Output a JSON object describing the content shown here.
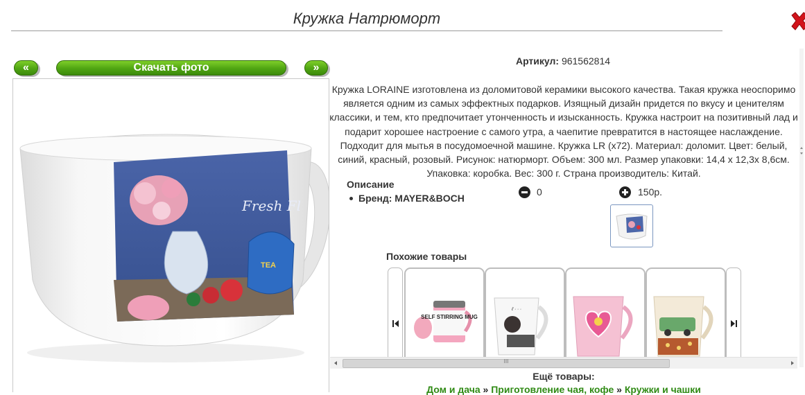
{
  "title": "Кружка Натрюморт",
  "nav": {
    "prev": "«",
    "download": "Скачать фото",
    "next": "»"
  },
  "article": {
    "label": "Артикул:",
    "value": "961562814"
  },
  "description": "Кружка LORAINE изготовлена из доломитовой керамики высокого качества. Такая кружка неоспоримо является одним из самых эффектных подарков. Изящный дизайн придется по вкусу и ценителям классики, и тем, кто предпочитает утонченность и изысканность. Кружка настроит на позитивный лад и подарит хорошее настроение с самого утра, а чаепитие превратится в настоящее наслаждение. Подходит для мытья в посудомоечной машине. Кружка LR (х72). Материал: доломит. Цвет: белый, синий, красный, розовый. Рисунок: натюрморт. Объем: 300 мл. Размер упаковки: 14,4 х 12,3х 8,6см. Упаковка: коробка. Вес: 300 г. Страна производитель: Китай.",
  "specs": {
    "heading": "Описание",
    "brand": "Бренд: MAYER&BOCH"
  },
  "quantity": {
    "minus_value": "0",
    "price": "150р."
  },
  "similar": {
    "heading": "Похожие товары",
    "cards": [
      {
        "label": "SELF STIRRING MUG"
      },
      {
        "label": ""
      },
      {
        "label": ""
      },
      {
        "label": ""
      }
    ]
  },
  "mug_print": {
    "text1": "Fresh Fl",
    "teapot": "TEA"
  },
  "scrollbar": {
    "grip": "III"
  },
  "more": {
    "heading": "Ещё товары:",
    "crumb1": "Дом и дача",
    "sep": "»",
    "crumb2": "Приготовление чая, кофе",
    "crumb3": "Кружки и чашки"
  }
}
